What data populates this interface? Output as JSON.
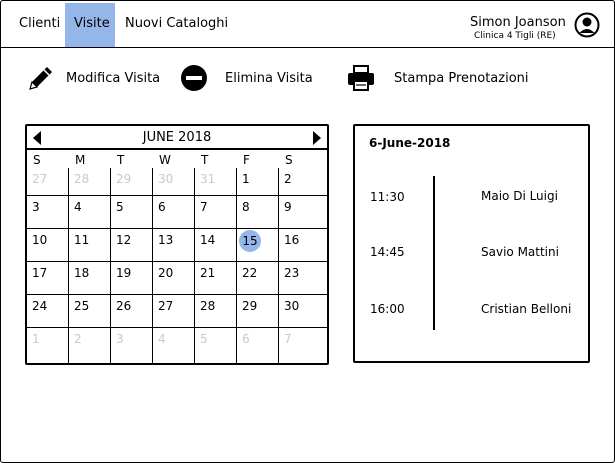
{
  "nav": {
    "items": [
      {
        "label": "Clienti",
        "active": false
      },
      {
        "label": "Visite",
        "active": true
      },
      {
        "label": "Nuovi Cataloghi",
        "active": false
      }
    ]
  },
  "user": {
    "name": "Simon Joanson",
    "clinic": "Clinica 4 Tigli (RE)",
    "icon": "user-avatar-icon"
  },
  "toolbar": {
    "edit_label": "Modifica Visita",
    "delete_label": "Elimina Visita",
    "print_label": "Stampa Prenotazioni"
  },
  "calendar": {
    "title": "JUNE 2018",
    "weekdays": [
      "S",
      "M",
      "T",
      "W",
      "T",
      "F",
      "S"
    ],
    "weeks": [
      [
        "27",
        "28",
        "29",
        "30",
        "31",
        "1",
        "2"
      ],
      [
        "3",
        "4",
        "5",
        "6",
        "7",
        "8",
        "9"
      ],
      [
        "10",
        "11",
        "12",
        "13",
        "14",
        "15",
        "16"
      ],
      [
        "17",
        "18",
        "19",
        "20",
        "21",
        "22",
        "23"
      ],
      [
        "24",
        "25",
        "26",
        "27",
        "28",
        "29",
        "30"
      ],
      [
        "1",
        "2",
        "3",
        "4",
        "5",
        "6",
        "7"
      ]
    ],
    "selected": "15",
    "highlight_color": "#95b6e8"
  },
  "agenda": {
    "date": "6-June-2018",
    "appointments": [
      {
        "time": "11:30",
        "name": "Maio Di Luigi"
      },
      {
        "time": "14:45",
        "name": "Savio Mattini"
      },
      {
        "time": "16:00",
        "name": "Cristian Belloni"
      }
    ]
  }
}
